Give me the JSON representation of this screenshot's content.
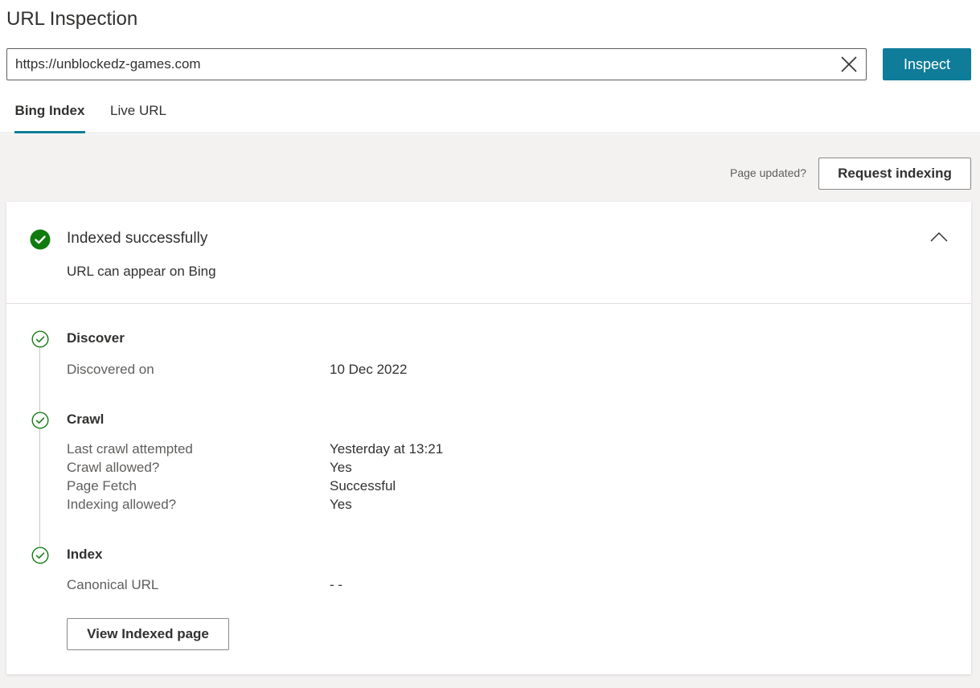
{
  "header": {
    "title": "URL Inspection",
    "url_value": "https://unblockedz-games.com",
    "inspect_label": "Inspect"
  },
  "tabs": [
    {
      "label": "Bing Index",
      "active": true
    },
    {
      "label": "Live URL",
      "active": false
    }
  ],
  "toolbar": {
    "page_updated_text": "Page updated?",
    "request_indexing_label": "Request indexing"
  },
  "status": {
    "title": "Indexed successfully",
    "subtitle": "URL can appear on Bing",
    "icon": "check-circle-filled-icon",
    "color": "#107c10"
  },
  "steps": [
    {
      "title": "Discover",
      "rows": [
        {
          "label": "Discovered on",
          "value": "10 Dec 2022"
        }
      ]
    },
    {
      "title": "Crawl",
      "rows": [
        {
          "label": "Last crawl attempted",
          "value": "Yesterday at 13:21"
        },
        {
          "label": "Crawl allowed?",
          "value": "Yes"
        },
        {
          "label": "Page Fetch",
          "value": "Successful"
        },
        {
          "label": "Indexing allowed?",
          "value": "Yes"
        }
      ]
    },
    {
      "title": "Index",
      "rows": [
        {
          "label": "Canonical URL",
          "value": "- -"
        }
      ]
    }
  ],
  "actions": {
    "view_indexed_label": "View Indexed page"
  },
  "colors": {
    "accent": "#0f7c99",
    "success": "#107c10",
    "background": "#f3f2f1"
  }
}
